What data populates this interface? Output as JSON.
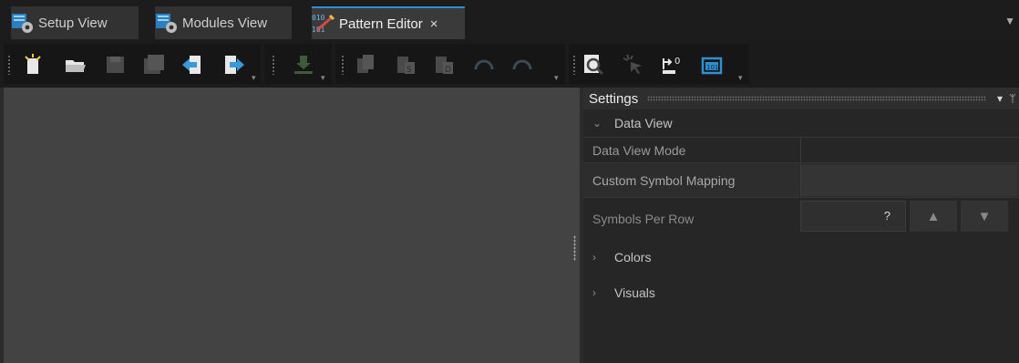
{
  "tabs": [
    {
      "label": "Setup View",
      "icon": "setup-view-icon"
    },
    {
      "label": "Modules View",
      "icon": "modules-view-icon"
    },
    {
      "label": "Pattern Editor",
      "icon": "pattern-editor-icon",
      "active": true,
      "close": "×"
    }
  ],
  "toolbar": {
    "icons": [
      "new-file-icon",
      "open-folder-icon",
      "save-icon",
      "save-all-icon",
      "import-icon",
      "export-icon",
      "download-icon",
      "copy-icon",
      "paste-special-icon",
      "paste-icon",
      "undo-icon",
      "redo-icon",
      "zoom-fit-icon",
      "select-pointer-icon",
      "go-to-zero-icon",
      "binary-view-icon"
    ],
    "zero_label": "0",
    "binary_label": "101"
  },
  "settings": {
    "title": "Settings",
    "data_view_section": "Data View",
    "rows": {
      "data_view_mode": "Data View Mode",
      "custom_symbol_mapping": "Custom Symbol Mapping",
      "symbols_per_row": "Symbols Per Row",
      "symbols_per_row_value": "?"
    },
    "colors_section": "Colors",
    "visuals_section": "Visuals"
  }
}
